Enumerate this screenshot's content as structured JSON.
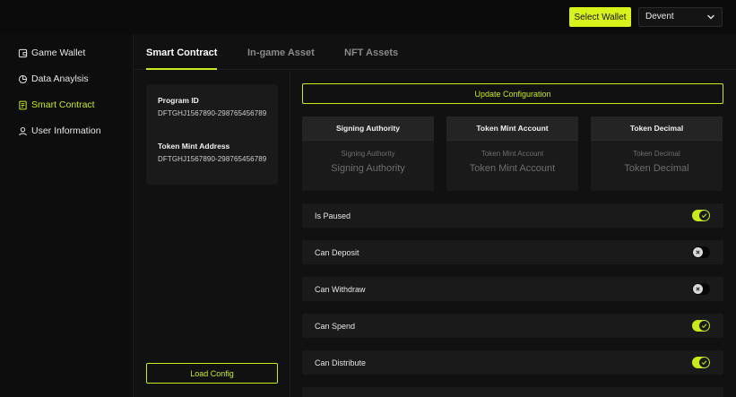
{
  "topbar": {
    "select_wallet_label": "Select Wallet",
    "network_value": "Devent"
  },
  "sidebar": {
    "items": [
      {
        "label": "Game Wallet",
        "icon": "wallet-icon"
      },
      {
        "label": "Data Anaylsis",
        "icon": "analysis-icon"
      },
      {
        "label": "Smart Contract",
        "icon": "document-icon",
        "active": true
      },
      {
        "label": "User Information",
        "icon": "user-icon"
      }
    ]
  },
  "tabs": [
    {
      "label": "Smart Contract",
      "active": true
    },
    {
      "label": "In-game Asset"
    },
    {
      "label": "NFT Assets"
    }
  ],
  "info": {
    "program_id_label": "Program ID",
    "program_id_value": "DFTGHJ1567890-298765456789",
    "token_mint_label": "Token Mint Address",
    "token_mint_value": "DFTGHJ1567890-298765456789"
  },
  "load_config_label": "Load Config",
  "update_config_label": "Update Configuration",
  "cards": [
    {
      "title": "Signing Authority",
      "sub": "Signing Authority",
      "value": "Signing Authority"
    },
    {
      "title": "Token Mint Account",
      "sub": "Token Mint Account",
      "value": "Token Mint Account"
    },
    {
      "title": "Token Decimal",
      "sub": "Token Decimal",
      "value": "Token Decimal"
    }
  ],
  "toggles": [
    {
      "label": "Is Paused",
      "on": true
    },
    {
      "label": "Can Deposit",
      "on": false
    },
    {
      "label": "Can Withdraw",
      "on": false
    },
    {
      "label": "Can Spend",
      "on": true
    },
    {
      "label": "Can Distribute",
      "on": true
    }
  ],
  "colors": {
    "accent": "#c9e81e",
    "button_fill": "#d8f31c",
    "background": "#0d0d0d",
    "panel": "#1a1a1a"
  }
}
